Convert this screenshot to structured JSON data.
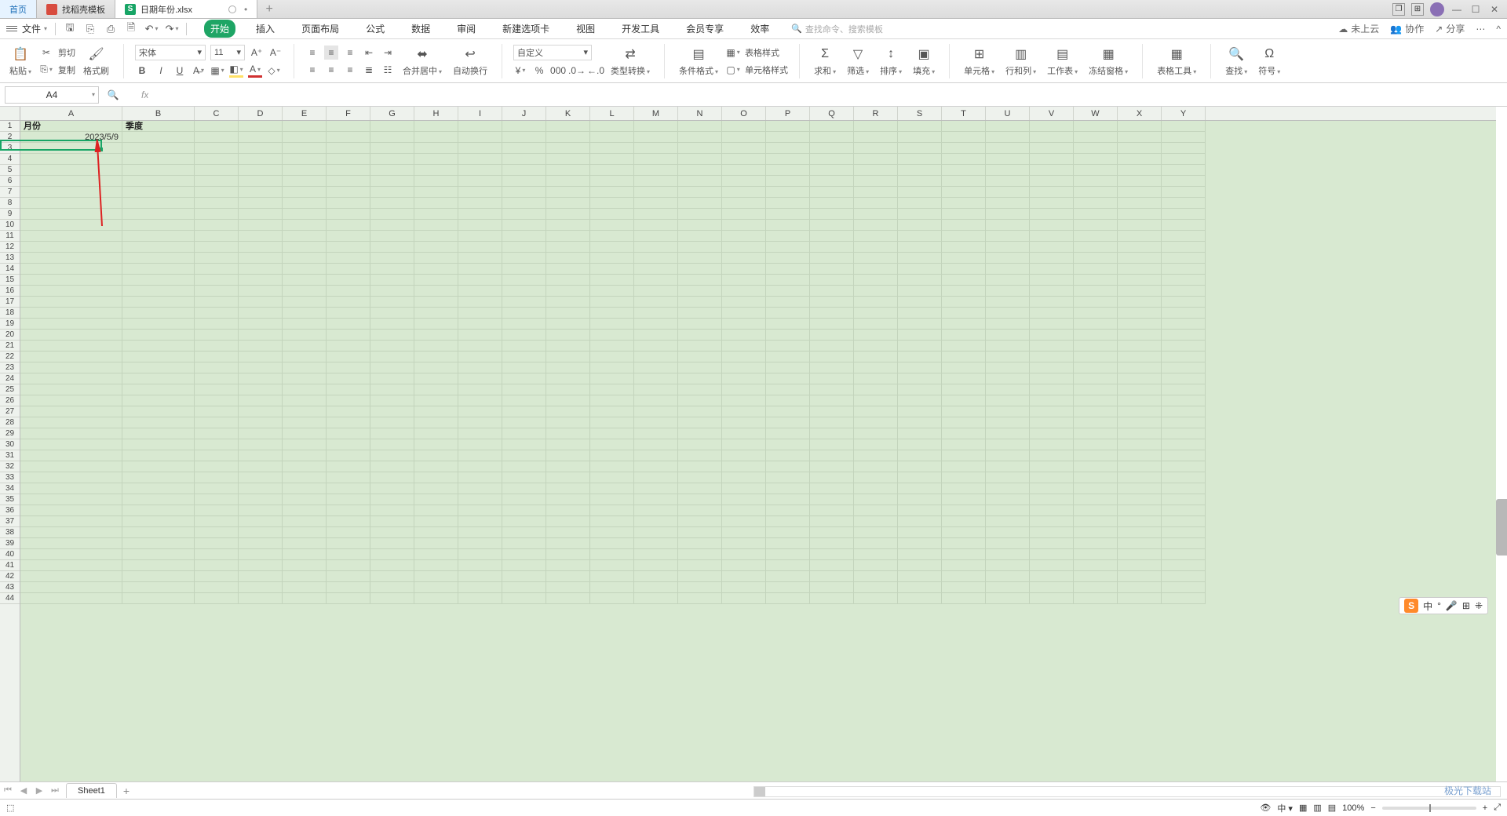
{
  "tabs": {
    "home": "首页",
    "template": "找稻壳模板",
    "file": "日期年份.xlsx"
  },
  "menu": {
    "file": "文件",
    "ribbon": [
      "开始",
      "插入",
      "页面布局",
      "公式",
      "数据",
      "审阅",
      "新建选项卡",
      "视图",
      "开发工具",
      "会员专享",
      "效率"
    ],
    "search_placeholder": "查找命令、搜索模板",
    "cloud": "未上云",
    "collab": "协作",
    "share": "分享"
  },
  "ribbon": {
    "paste": "粘贴",
    "cut": "剪切",
    "copy": "复制",
    "brush": "格式刷",
    "font_name": "宋体",
    "font_size": "11",
    "merge": "合并居中",
    "wrap": "自动换行",
    "num_format": "自定义",
    "type_convert": "类型转换",
    "cond_fmt": "条件格式",
    "table_style": "表格样式",
    "cell_style": "单元格样式",
    "sum": "求和",
    "filter": "筛选",
    "sort": "排序",
    "fill": "填充",
    "cells": "单元格",
    "rowscols": "行和列",
    "worksheet": "工作表",
    "freeze": "冻结窗格",
    "table_tools": "表格工具",
    "find": "查找",
    "symbols": "符号"
  },
  "namebox": "A4",
  "sheet": {
    "headers": {
      "A": "月份",
      "B": "季度"
    },
    "A2": "2023/5/9"
  },
  "columns": [
    "A",
    "B",
    "C",
    "D",
    "E",
    "F",
    "G",
    "H",
    "I",
    "J",
    "K",
    "L",
    "M",
    "N",
    "O",
    "P",
    "Q",
    "R",
    "S",
    "T",
    "U",
    "V",
    "W",
    "X",
    "Y"
  ],
  "ime": {
    "lang": "中",
    "dot": "°",
    "grid": "⊞",
    "apps": "⁜"
  },
  "sheet_tab": "Sheet1",
  "status": {
    "zoom": "100%"
  },
  "watermark": "极光下载站"
}
